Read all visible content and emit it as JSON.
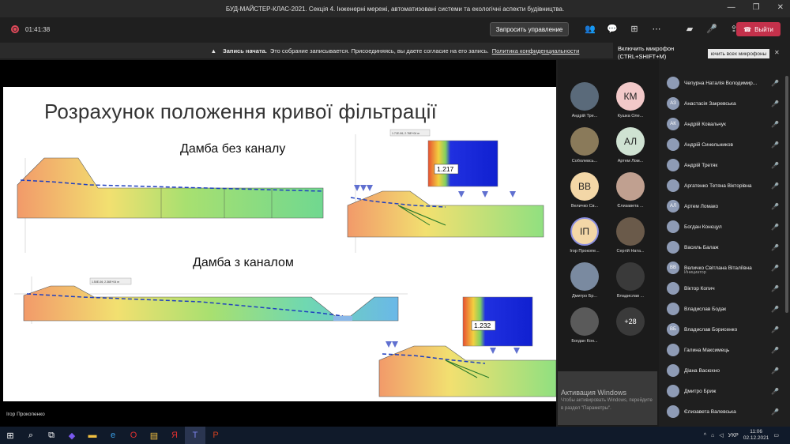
{
  "window": {
    "title": "БУД-МАЙСТЕР-КЛАС-2021. Секція 4. Інженерні мережі, автоматизовані системи та екологічні аспекти будівництва.",
    "controls": [
      "—",
      "❐",
      "✕"
    ]
  },
  "toolbar": {
    "timer": "01:41:38",
    "request_control": "Запросить управление",
    "leave": "Выйти"
  },
  "banner": {
    "bold": "Запись начата.",
    "text": "Это собрание записывается. Присоединяясь, вы даете согласие на его запись.",
    "link": "Политика конфиденциальности"
  },
  "tooltip": {
    "line1": "Включить микрофон",
    "line2": "(CTRL+SHIFT+M)",
    "button": "ючить всех микрофоны"
  },
  "slide": {
    "title": "Розрахунок положення кривої фільтрації",
    "subtitle1": "Дамба без каналу",
    "subtitle2": "Дамба з каналом",
    "factor1": "1.217",
    "factor2": "1.232",
    "label1": "1.71E-06; 2.76E+04 m",
    "label2": "1.50E-06; 2.36E+04 m"
  },
  "presenter": "Ігор Прокопенко",
  "tiles": [
    {
      "initials": "",
      "name": "Андрій Тре...",
      "color": "#5a6a7a"
    },
    {
      "initials": "КМ",
      "name": "Кушка Оле...",
      "color": "#f2c9c9"
    },
    {
      "initials": "",
      "name": "Соболевсь...",
      "color": "#8a7a5a"
    },
    {
      "initials": "АЛ",
      "name": "Артем Лом...",
      "color": "#cfe2d2"
    },
    {
      "initials": "ВВ",
      "name": "Величко Св...",
      "color": "#f3d7a7"
    },
    {
      "initials": "",
      "name": "Єлизавета ...",
      "color": "#c0a090"
    },
    {
      "initials": "ІП",
      "name": "Ігор Прокопе...",
      "color": "#f3d7a7"
    },
    {
      "initials": "",
      "name": "Сергій Ната...",
      "color": "#6a5a4a"
    },
    {
      "initials": "",
      "name": "Дмитро Бр...",
      "color": "#7a8aa0"
    },
    {
      "initials": "",
      "name": "Владислав ...",
      "color": "#3a3a3a"
    },
    {
      "initials": "",
      "name": "Богдан Кон...",
      "color": "#5a5a5a"
    },
    {
      "initials": "+28",
      "name": "",
      "color": "#3a3a3a"
    }
  ],
  "participants": [
    {
      "initials": "",
      "name": "Чепурна Наталія Володимир...",
      "sub": ""
    },
    {
      "initials": "АЗ",
      "name": "Анастасія Закревська",
      "sub": ""
    },
    {
      "initials": "АК",
      "name": "Андрій Ковальчук",
      "sub": ""
    },
    {
      "initials": "",
      "name": "Андрій Синельников",
      "sub": ""
    },
    {
      "initials": "",
      "name": "Андрій Третяк",
      "sub": ""
    },
    {
      "initials": "",
      "name": "Аргатенко Тетяна Вікторівна",
      "sub": ""
    },
    {
      "initials": "АЛ",
      "name": "Артем Ломако",
      "sub": ""
    },
    {
      "initials": "",
      "name": "Богдан Конєцул",
      "sub": ""
    },
    {
      "initials": "",
      "name": "Василь Балаж",
      "sub": ""
    },
    {
      "initials": "ВВ",
      "name": "Величко Світлана Віталіївна",
      "sub": "Инициатор"
    },
    {
      "initials": "",
      "name": "Віктор Копич",
      "sub": ""
    },
    {
      "initials": "",
      "name": "Владислав Бодак",
      "sub": ""
    },
    {
      "initials": "ВБ",
      "name": "Владислав Борисенко",
      "sub": ""
    },
    {
      "initials": "",
      "name": "Галина Максимець",
      "sub": ""
    },
    {
      "initials": "",
      "name": "Діана Васюхно",
      "sub": ""
    },
    {
      "initials": "",
      "name": "Дмитро Бриж",
      "sub": ""
    },
    {
      "initials": "",
      "name": "Єлизавета Валевська",
      "sub": ""
    }
  ],
  "watermark": {
    "title": "Активация Windows",
    "text": "Чтобы активировать Windows, перейдите в раздел \"Параметры\"."
  },
  "taskbar": {
    "lang": "УКР",
    "time": "11:06",
    "date": "02.12.2021"
  }
}
